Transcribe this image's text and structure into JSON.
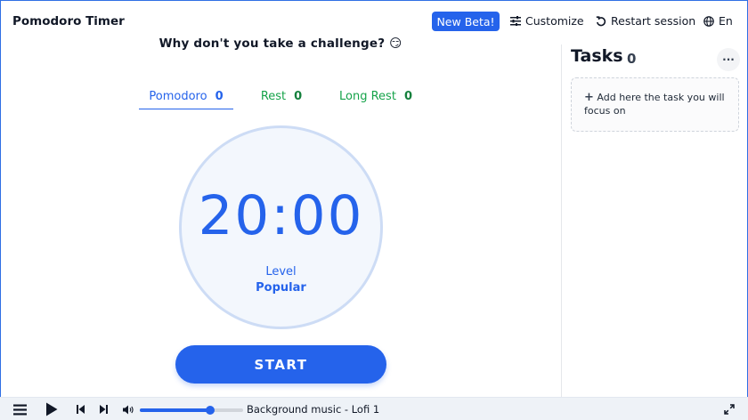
{
  "header": {
    "app_title": "Pomodoro Timer",
    "beta_label": "New Beta!",
    "customize_label": "Customize",
    "restart_label": "Restart session",
    "language_label": "En"
  },
  "challenge_text": "Why don't you take a challenge? 😏",
  "tabs": [
    {
      "label": "Pomodoro",
      "count": "0"
    },
    {
      "label": "Rest",
      "count": "0"
    },
    {
      "label": "Long Rest",
      "count": "0"
    }
  ],
  "timer": {
    "time": "20:00",
    "level_label": "Level",
    "level_value": "Popular"
  },
  "start_label": "START",
  "tasks": {
    "title": "Tasks",
    "count": "0",
    "more_label": "···",
    "add_label": "Add here the task you will focus on"
  },
  "player": {
    "track": "Background music - Lofi 1",
    "volume_fraction": 0.68
  },
  "colors": {
    "accent": "#2563eb",
    "rest": "#16a34a",
    "timer_bg": "#f3f7fd",
    "player_bg": "#eef2f7"
  },
  "icons": [
    "sliders-icon",
    "restart-icon",
    "globe-icon",
    "plus-icon",
    "menu-icon",
    "play-icon",
    "previous-icon",
    "next-icon",
    "volume-icon",
    "fullscreen-icon"
  ]
}
